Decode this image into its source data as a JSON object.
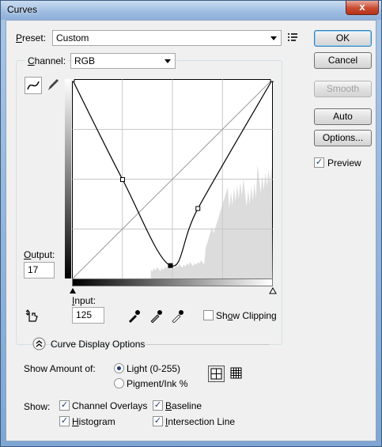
{
  "window": {
    "title": "Curves",
    "close_label": "x"
  },
  "preset": {
    "label": "Preset:",
    "value": "Custom"
  },
  "channel": {
    "label": "Channel:",
    "value": "RGB"
  },
  "output": {
    "label": "Output:",
    "value": "17"
  },
  "input": {
    "label": "Input:",
    "value": "125"
  },
  "buttons": {
    "ok": "OK",
    "cancel": "Cancel",
    "smooth": "Smooth",
    "auto": "Auto",
    "options": "Options..."
  },
  "preview": {
    "label": "Preview",
    "checked": true
  },
  "show_clipping": {
    "label": "Show Clipping",
    "checked": false
  },
  "curve_display_options": {
    "label": "Curve Display Options"
  },
  "show_amount": {
    "label": "Show Amount of:",
    "options": [
      {
        "label": "Light  (0-255)",
        "selected": true
      },
      {
        "label": "Pigment/Ink %",
        "selected": false
      }
    ]
  },
  "show": {
    "label": "Show:",
    "items": [
      {
        "label": "Channel Overlays",
        "checked": true
      },
      {
        "label": "Baseline",
        "checked": true
      },
      {
        "label": "Histogram",
        "checked": true
      },
      {
        "label": "Intersection Line",
        "checked": true
      }
    ]
  },
  "curve": {
    "points": [
      [
        0,
        255
      ],
      [
        64,
        127
      ],
      [
        125,
        17
      ],
      [
        160,
        90
      ],
      [
        255,
        255
      ]
    ],
    "point_labels": "input/output levels 0-255"
  }
}
